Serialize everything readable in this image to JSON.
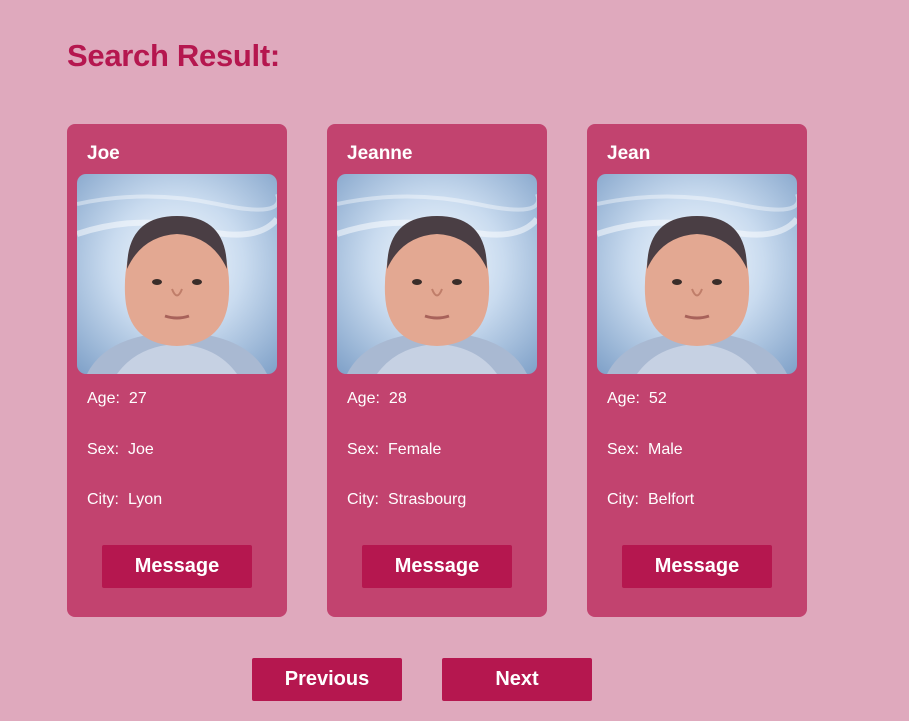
{
  "page": {
    "title": "Search Result:"
  },
  "labels": {
    "age": "Age:",
    "sex": "Sex:",
    "city": "City:"
  },
  "results": [
    {
      "name": "Joe",
      "age": "27",
      "sex": "Joe",
      "city": "Lyon",
      "message_label": "Message"
    },
    {
      "name": "Jeanne",
      "age": "28",
      "sex": "Female",
      "city": "Strasbourg",
      "message_label": "Message"
    },
    {
      "name": "Jean",
      "age": "52",
      "sex": "Male",
      "city": "Belfort",
      "message_label": "Message"
    }
  ],
  "pagination": {
    "previous_label": "Previous",
    "next_label": "Next"
  },
  "colors": {
    "background": "#dfa9bd",
    "card": "#c2436f",
    "accent": "#b5174f",
    "text_on_card": "#ffffff"
  }
}
